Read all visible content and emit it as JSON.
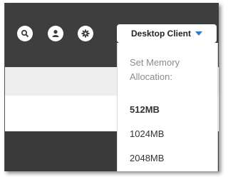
{
  "toolbar": {
    "icons": [
      {
        "name": "search-icon"
      },
      {
        "name": "user-icon"
      },
      {
        "name": "gear-icon"
      }
    ]
  },
  "client_dropdown": {
    "label": "Desktop Client",
    "caret_icon": "caret-down-icon",
    "accent_color": "#2a7bd8",
    "menu": {
      "header": "Set Memory Allocation:",
      "options": [
        {
          "label": "512MB",
          "selected": true
        },
        {
          "label": "1024MB",
          "selected": false
        },
        {
          "label": "2048MB",
          "selected": false
        }
      ]
    }
  },
  "colors": {
    "topbar": "#3e3e3e",
    "content_band": "#eeeeee",
    "bottom_band": "#3a3a3a"
  }
}
